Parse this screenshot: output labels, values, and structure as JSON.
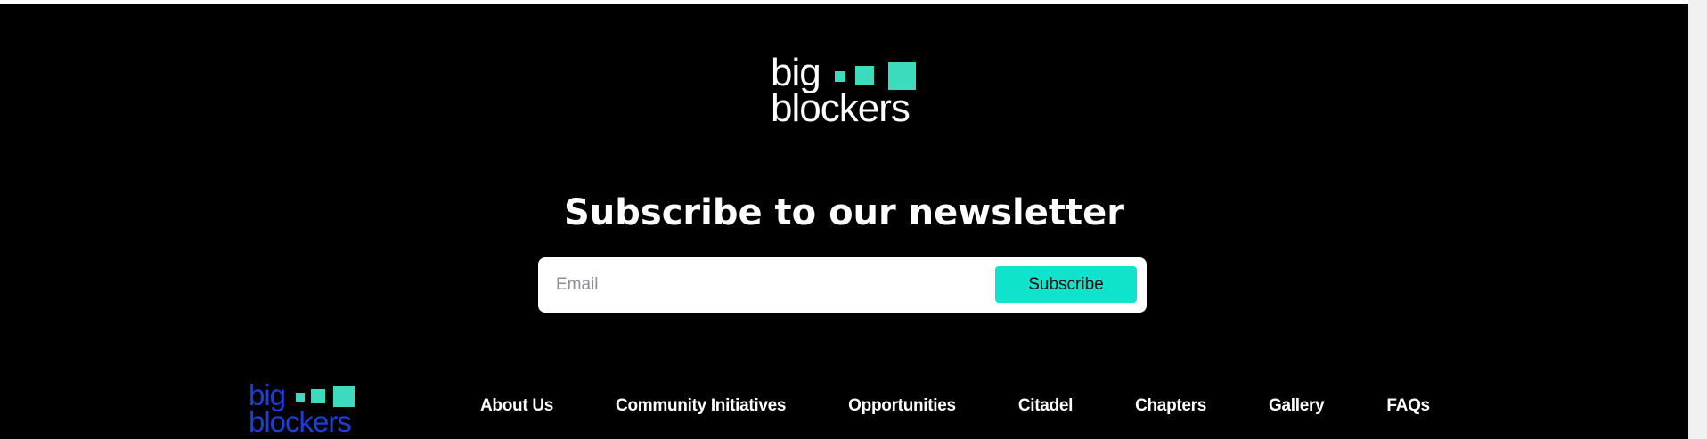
{
  "brand": {
    "logo_line1": "big",
    "logo_line2": "blockers",
    "accent_color": "#3ddbbd",
    "footer_logo_color": "#1e3ed6"
  },
  "newsletter": {
    "heading": "Subscribe to our newsletter",
    "email_placeholder": "Email",
    "email_value": "",
    "subscribe_label": "Subscribe",
    "button_color": "#0fe3cc"
  },
  "footer": {
    "nav": [
      {
        "label": "About Us"
      },
      {
        "label": "Community Initiatives"
      },
      {
        "label": "Opportunities"
      },
      {
        "label": "Citadel"
      },
      {
        "label": "Chapters"
      },
      {
        "label": "Gallery"
      },
      {
        "label": "FAQs"
      }
    ]
  }
}
